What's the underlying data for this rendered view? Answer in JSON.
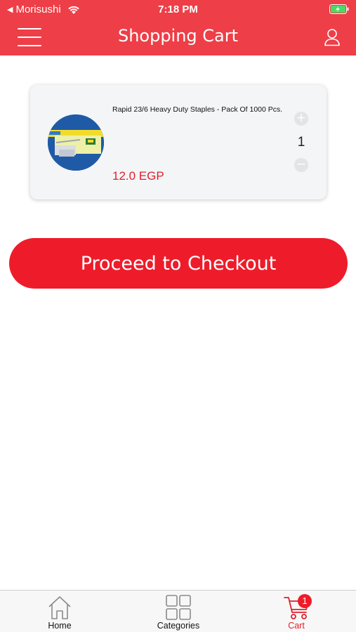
{
  "status_bar": {
    "back_glyph": "◀",
    "carrier": "Morisushi",
    "time": "7:18 PM",
    "wifi_icon": "wifi-icon",
    "battery_icon": "battery-charging-icon"
  },
  "nav": {
    "title": "Shopping Cart",
    "menu_icon": "hamburger-menu-icon",
    "user_icon": "user-icon"
  },
  "cart": {
    "items": [
      {
        "name": "Rapid 23/6 Heavy Duty Staples - Pack Of 1000 Pcs.",
        "price": "12.0 EGP",
        "quantity": "1",
        "plus_label": "+",
        "minus_label": "−"
      }
    ],
    "checkout_label": "Proceed to Checkout"
  },
  "tabbar": {
    "tabs": [
      {
        "label": "Home",
        "icon": "home-icon"
      },
      {
        "label": "Categories",
        "icon": "grid-icon"
      },
      {
        "label": "Cart",
        "icon": "cart-icon",
        "badge": "1",
        "active": true
      }
    ]
  },
  "colors": {
    "header": "#ee3e47",
    "accent": "#ee1c2a",
    "price": "#e0202b"
  }
}
